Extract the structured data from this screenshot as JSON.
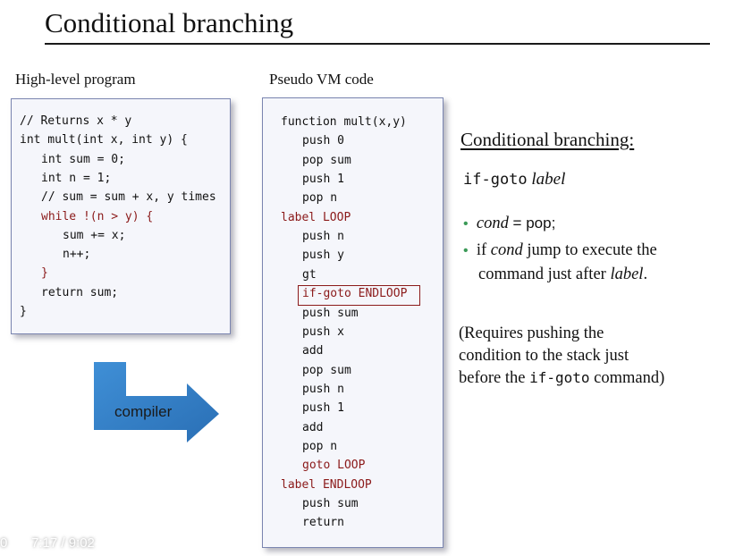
{
  "slide": {
    "title": "Conditional branching",
    "left_caption": "High-level program",
    "middle_caption": "Pseudo VM code",
    "arrow_label": "compiler"
  },
  "high_level_program": [
    {
      "text": "// Returns x * y",
      "indent": 0,
      "red": false
    },
    {
      "text": "int mult(int x, int y) {",
      "indent": 0,
      "red": false
    },
    {
      "text": "int sum = 0;",
      "indent": 1,
      "red": false
    },
    {
      "text": "int n = 1;",
      "indent": 1,
      "red": false
    },
    {
      "text": "// sum = sum + x, y times",
      "indent": 1,
      "red": false
    },
    {
      "text": "while !(n > y) {",
      "indent": 1,
      "red": true
    },
    {
      "text": "sum += x;",
      "indent": 2,
      "red": false
    },
    {
      "text": "n++;",
      "indent": 2,
      "red": false
    },
    {
      "text": "}",
      "indent": 1,
      "red": true
    },
    {
      "text": "return sum;",
      "indent": 1,
      "red": false
    },
    {
      "text": "}",
      "indent": 0,
      "red": false
    }
  ],
  "vm_code": [
    {
      "text": "function mult(x,y)",
      "indent": 0,
      "red": false
    },
    {
      "text": "push 0",
      "indent": 1,
      "red": false
    },
    {
      "text": "pop sum",
      "indent": 1,
      "red": false
    },
    {
      "text": "push 1",
      "indent": 1,
      "red": false
    },
    {
      "text": "pop n",
      "indent": 1,
      "red": false
    },
    {
      "text": "label LOOP",
      "indent": 0,
      "red": true
    },
    {
      "text": "push n",
      "indent": 1,
      "red": false
    },
    {
      "text": "push y",
      "indent": 1,
      "red": false
    },
    {
      "text": "gt",
      "indent": 1,
      "red": false
    },
    {
      "text": "if-goto ENDLOOP",
      "indent": 1,
      "red": true,
      "boxed": true
    },
    {
      "text": "push sum",
      "indent": 1,
      "red": false
    },
    {
      "text": "push x",
      "indent": 1,
      "red": false
    },
    {
      "text": "add",
      "indent": 1,
      "red": false
    },
    {
      "text": "pop sum",
      "indent": 1,
      "red": false
    },
    {
      "text": "push n",
      "indent": 1,
      "red": false
    },
    {
      "text": "push 1",
      "indent": 1,
      "red": false
    },
    {
      "text": "add",
      "indent": 1,
      "red": false
    },
    {
      "text": "pop n",
      "indent": 1,
      "red": false
    },
    {
      "text": "goto LOOP",
      "indent": 1,
      "red": true
    },
    {
      "text": "label ENDLOOP",
      "indent": 0,
      "red": true
    },
    {
      "text": "push sum",
      "indent": 1,
      "red": false
    },
    {
      "text": "return",
      "indent": 1,
      "red": false
    }
  ],
  "explanation": {
    "heading": "Conditional branching:",
    "syntax_keyword": "if-goto",
    "syntax_arg": "label",
    "bullet1": {
      "dot": "•",
      "cond": "cond",
      "rest": " = pop;"
    },
    "bullet2": {
      "dot": "•",
      "pre": "if ",
      "cond": "cond",
      "post": " jump to execute the",
      "line2_pre": "command just after ",
      "line2_label": "label",
      "line2_end": "."
    },
    "note": {
      "line1": "(Requires pushing the",
      "line2": "condition to the stack just",
      "line3_pre": "before the ",
      "line3_code": "if-goto",
      "line3_post": " command)"
    }
  },
  "video": {
    "time": "7:17  /  9:02",
    "corner": "0"
  },
  "colors": {
    "keyword_red": "#8b1a1a",
    "bullet_green": "#3b9a57",
    "box_border": "#7a85b0",
    "arrow_blue": "#2e78bf"
  }
}
